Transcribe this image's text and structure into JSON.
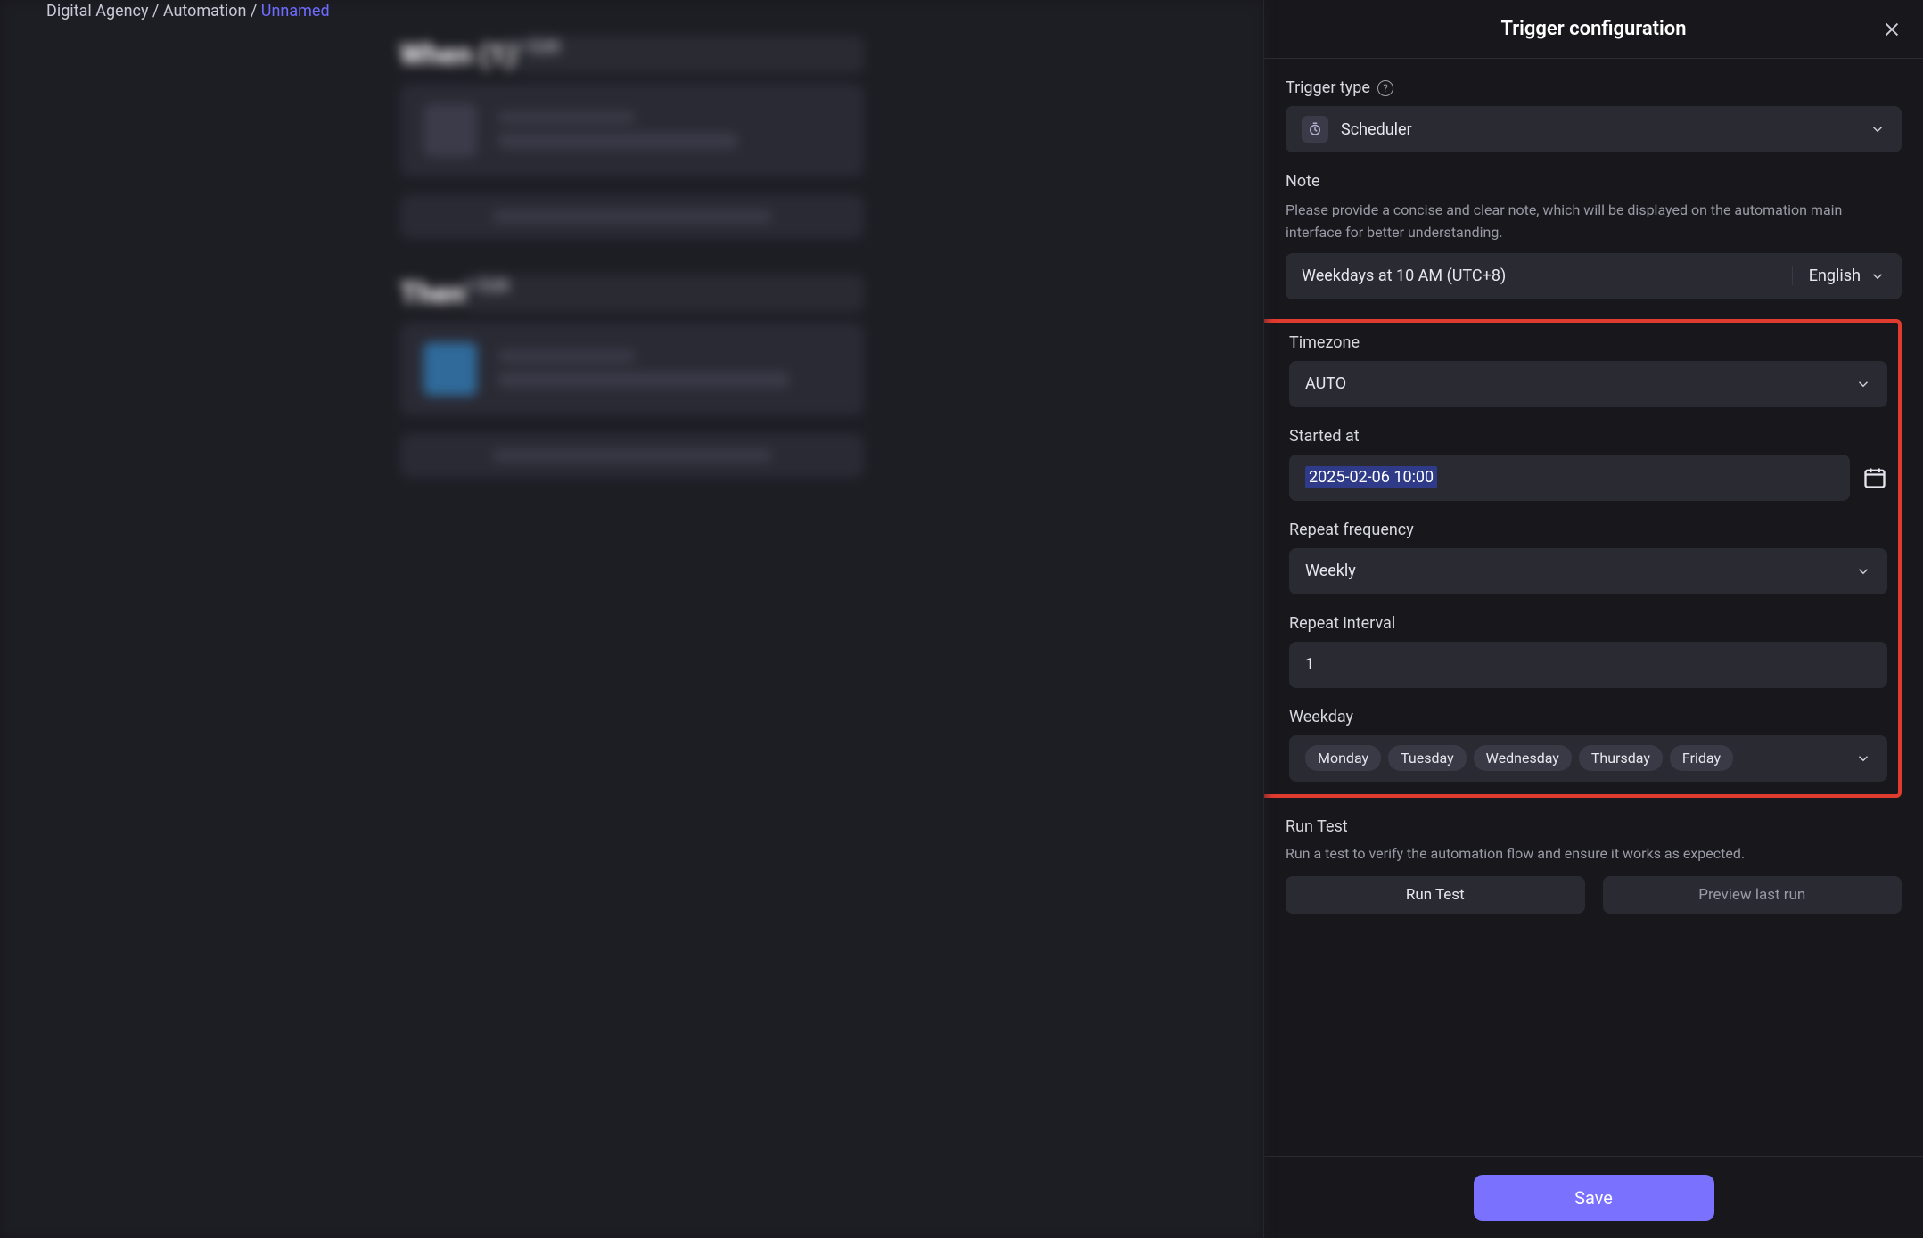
{
  "breadcrumb": {
    "prefix": "Digital Agency / Automation / ",
    "link": "Unnamed"
  },
  "bg": {
    "block1": {
      "title": "When (1)",
      "edit": "+ Edit"
    },
    "block2": {
      "title": "Then",
      "edit": "+ Edit"
    }
  },
  "panel": {
    "title": "Trigger configuration",
    "trigger_type": {
      "label": "Trigger type",
      "value": "Scheduler"
    },
    "note": {
      "label": "Note",
      "help": "Please provide a concise and clear note, which will be displayed on the automation main interface for better understanding.",
      "value": "Weekdays at 10 AM (UTC+8)",
      "language": "English"
    },
    "timezone": {
      "label": "Timezone",
      "value": "AUTO"
    },
    "started_at": {
      "label": "Started at",
      "value": "2025-02-06 10:00"
    },
    "repeat_frequency": {
      "label": "Repeat frequency",
      "value": "Weekly"
    },
    "repeat_interval": {
      "label": "Repeat interval",
      "value": "1"
    },
    "weekday": {
      "label": "Weekday",
      "values": [
        "Monday",
        "Tuesday",
        "Wednesday",
        "Thursday",
        "Friday"
      ]
    },
    "run_test": {
      "label": "Run Test",
      "help": "Run a test to verify the automation flow and ensure it works as expected.",
      "run_btn": "Run Test",
      "preview_btn": "Preview last run"
    },
    "save": "Save"
  }
}
